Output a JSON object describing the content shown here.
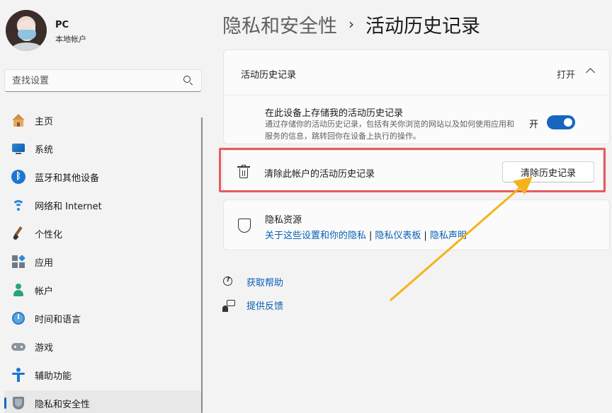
{
  "user": {
    "name": "PC",
    "account_type": "本地帐户"
  },
  "search": {
    "placeholder": "查找设置"
  },
  "sidebar": {
    "items": [
      {
        "label": "主页",
        "icon": "home-icon"
      },
      {
        "label": "系统",
        "icon": "system-icon"
      },
      {
        "label": "蓝牙和其他设备",
        "icon": "bluetooth-icon"
      },
      {
        "label": "网络和 Internet",
        "icon": "wifi-icon"
      },
      {
        "label": "个性化",
        "icon": "brush-icon"
      },
      {
        "label": "应用",
        "icon": "apps-icon"
      },
      {
        "label": "帐户",
        "icon": "account-icon"
      },
      {
        "label": "时间和语言",
        "icon": "time-language-icon"
      },
      {
        "label": "游戏",
        "icon": "gaming-icon"
      },
      {
        "label": "辅助功能",
        "icon": "accessibility-icon"
      },
      {
        "label": "隐私和安全性",
        "icon": "privacy-shield-icon",
        "active": true
      }
    ]
  },
  "breadcrumb": {
    "parent": "隐私和安全性",
    "separator": "›",
    "current": "活动历史记录"
  },
  "activity": {
    "title": "活动历史记录",
    "state": "打开",
    "store_label": "在此设备上存储我的活动历史记录",
    "store_description": "通过存储你的活动历史记录，包括有关你浏览的网站以及如何使用应用和服务的信息，跳转回你在设备上执行的操作。",
    "toggle_label": "开",
    "toggle_on": true
  },
  "clear": {
    "label": "清除此帐户的活动历史记录",
    "button": "清除历史记录"
  },
  "privacy": {
    "title": "隐私资源",
    "links": [
      "关于这些设置和你的隐私",
      "隐私仪表板",
      "隐私声明"
    ]
  },
  "help": {
    "get_help": "获取帮助",
    "feedback": "提供反馈"
  },
  "colors": {
    "accent": "#1765c1",
    "highlight": "#e8595e",
    "arrow": "#f5b31b"
  }
}
